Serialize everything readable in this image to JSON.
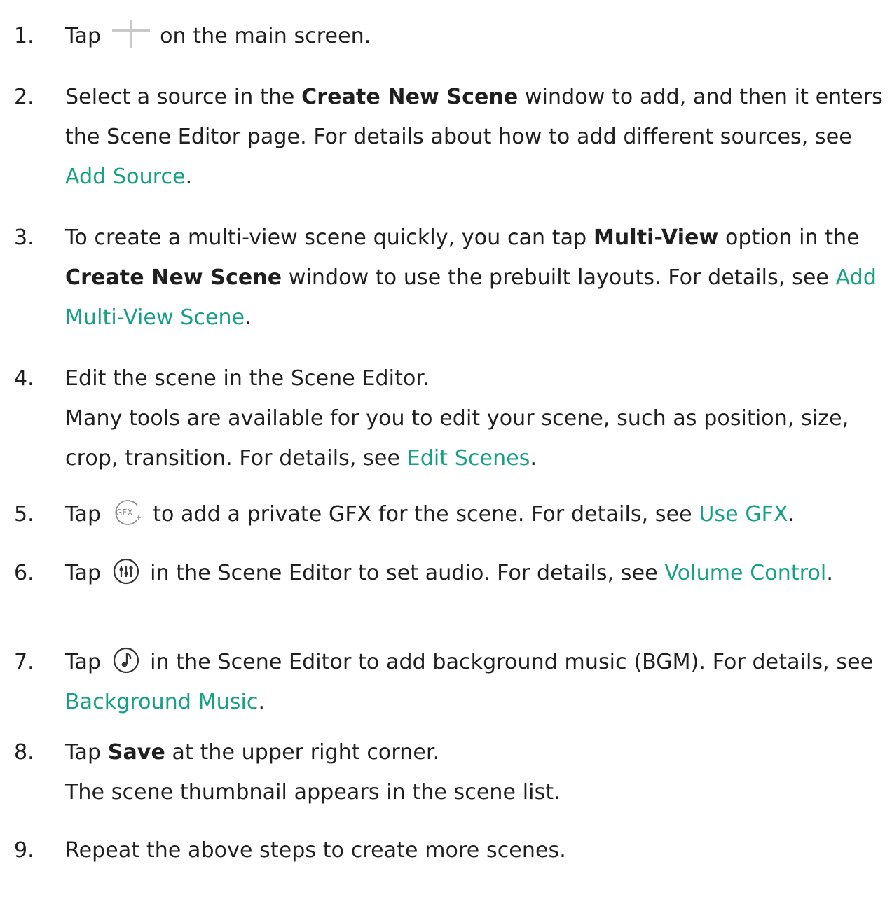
{
  "steps": [
    {
      "number": "1.",
      "before": "Tap",
      "icon": "plus-icon",
      "after": "on the main screen."
    },
    {
      "number": "2.",
      "part1": "Select a source in the ",
      "bold1": "Create New Scene",
      "part2": " window to add, and then it enters the Scene Editor page. For details about how to add different sources, see ",
      "link": "Add Source",
      "end": "."
    },
    {
      "number": "3.",
      "part1": "To create a multi-view scene quickly, you can tap ",
      "bold1": "Multi-View",
      "part2": " option in the ",
      "bold2": "Create New Scene",
      "part3": " window to use the prebuilt layouts. For details, see ",
      "link": "Add Multi-View Scene",
      "end": "."
    },
    {
      "number": "4.",
      "line1": "Edit the scene in the Scene Editor.",
      "part1": "Many tools are available for you to edit your scene, such as position, size, crop, transition. For details, see ",
      "link": "Edit Scenes",
      "end": "."
    },
    {
      "number": "5.",
      "before": "Tap",
      "icon": "gfx-add-icon",
      "icon_text": "GFX",
      "after": "to add a private GFX for the scene. For details, see ",
      "link": "Use GFX",
      "end": "."
    },
    {
      "number": "6.",
      "before": "Tap",
      "icon": "audio-mixer-icon",
      "after": "in the Scene Editor to set audio. For details, see ",
      "link": "Volume Control",
      "end": "."
    },
    {
      "number": "7.",
      "before": "Tap",
      "icon": "music-note-icon",
      "after": "in the Scene Editor to add background music (BGM). For details, see ",
      "link": "Background Music",
      "end": "."
    },
    {
      "number": "8.",
      "part1": "Tap ",
      "bold1": "Save",
      "part2": " at the upper right corner.",
      "line2": "The scene thumbnail appears in the scene list."
    },
    {
      "number": "9.",
      "line1": "Repeat the above steps to create more scenes."
    }
  ],
  "colors": {
    "text": "#1f1f1f",
    "link": "#16a085",
    "icon": "#888888",
    "plus_icon": "#c8c8c8"
  }
}
